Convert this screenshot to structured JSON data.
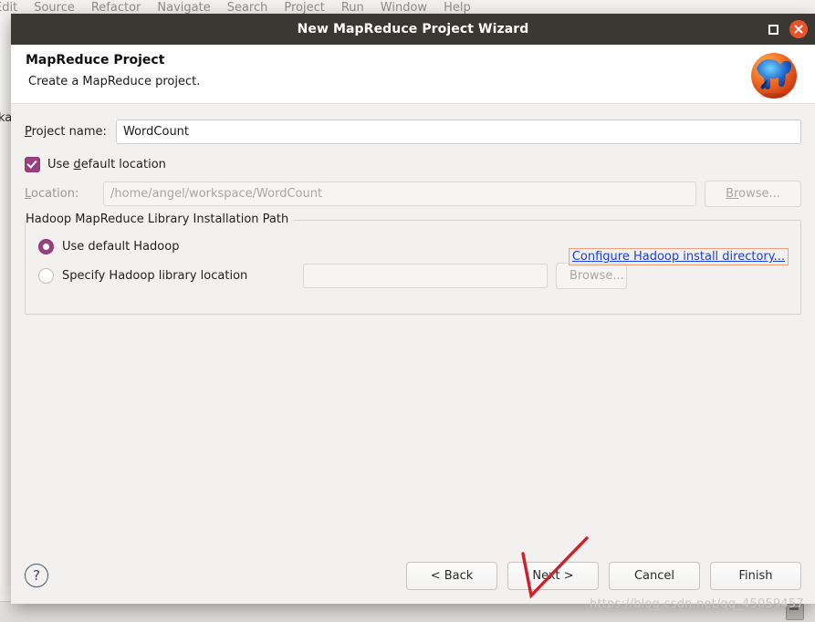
{
  "background": {
    "menu_items": [
      "Edit",
      "Source",
      "Refactor",
      "Navigate",
      "Search",
      "Project",
      "Run",
      "Window",
      "Help"
    ],
    "package_explorer_label": "kag",
    "save_icon": "save-icon",
    "tray_icon": "tray-icon"
  },
  "dialog": {
    "title": "New MapReduce Project Wizard",
    "maximize_icon": "maximize-icon",
    "close_icon": "close-icon",
    "header": {
      "title": "MapReduce Project",
      "description": "Create a MapReduce project.",
      "icon": "hadoop-elephant-icon"
    },
    "form": {
      "project_name_label_pre": "P",
      "project_name_label_post": "roject name:",
      "project_name_value": "WordCount",
      "use_default_location_pre": "Use ",
      "use_default_location_mn": "d",
      "use_default_location_post": "efault location",
      "use_default_location_checked": true,
      "location_label_pre": "L",
      "location_label_post": "ocation:",
      "location_value": "/home/angel/workspace/WordCount",
      "location_browse_label_pre": "B",
      "location_browse_label_mn": "r",
      "location_browse_label_post": "owse...",
      "location_browse_disabled": true
    },
    "group": {
      "title": "Hadoop MapReduce Library Installation Path",
      "radio_default_label": "Use default Hadoop",
      "radio_default_selected": true,
      "radio_specify_label": "Specify Hadoop library location",
      "radio_specify_selected": false,
      "specify_input_value": "",
      "specify_browse_label": "Browse...",
      "specify_browse_disabled": true,
      "configure_link_label": "Configure Hadoop install directory..."
    },
    "footer": {
      "help_label": "?",
      "back_label": "< Back",
      "next_label": "Next >",
      "cancel_label": "Cancel",
      "finish_label": "Finish"
    }
  },
  "annotation": {
    "shape": "red-checkmark",
    "color": "#d0202a"
  },
  "watermark": {
    "text": "https://blog.csdn.net/qq_45059457",
    "color": "#c9c6c2"
  },
  "colors": {
    "titlebar": "#3b3733",
    "close_button": "#e8522a",
    "accent_purple": "#99407f",
    "link_blue": "#1a3fe0",
    "focus_border": "#f0a080"
  }
}
